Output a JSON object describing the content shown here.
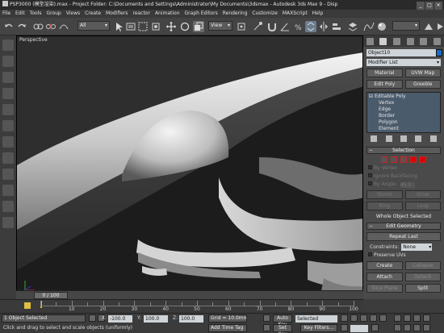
{
  "window": {
    "title": "PSP3000 (模型渲染).max  - Project Folder: C:\\Documents and Settings\\Administrator\\My Documents\\3dsmax   - Autodesk 3ds Max 9   - Disp"
  },
  "menu": [
    "File",
    "Edit",
    "Tools",
    "Group",
    "Views",
    "Create",
    "Modifiers",
    "reactor",
    "Animation",
    "Graph Editors",
    "Rendering",
    "Customize",
    "MAXScript",
    "Help"
  ],
  "toolbar": {
    "selection_filter": "All",
    "ref_coord": "View"
  },
  "viewport": {
    "label": "Perspective"
  },
  "command_panel": {
    "object_name": "Object10",
    "object_color": "#1b6dc1",
    "modifier_list": "Modifier List",
    "buttons_row1": [
      "Material",
      "UVW Map"
    ],
    "buttons_row2": [
      "Edit Poly",
      "Greeble"
    ],
    "stack": {
      "root": "Editable Poly",
      "subobjects": [
        "Vertex",
        "Edge",
        "Border",
        "Polygon",
        "Element"
      ]
    },
    "selection_rollout": {
      "title": "Selection",
      "checks": [
        "By Vertex",
        "Ignore Backfacing",
        "By Angle:"
      ],
      "angle_value": "45.0",
      "shrink": "Shrink",
      "grow": "Grow",
      "ring": "Ring",
      "loop": "Loop",
      "status": "Whole Object Selected"
    },
    "edit_geometry": {
      "title": "Edit Geometry",
      "repeat_last": "Repeat Last",
      "constraints_label": "Constraints:",
      "constraints_value": "None",
      "preserve_uvs": "Preserve UVs",
      "create": "Create",
      "collapse": "Collapse",
      "attach": "Attach",
      "detach": "Detach",
      "slice_plane": "Slice Plane",
      "split": "Split"
    }
  },
  "timeline": {
    "slider_label": "0 / 100",
    "ticks": [
      "0",
      "10",
      "20",
      "30",
      "40",
      "50",
      "60",
      "70",
      "80",
      "90",
      "100"
    ]
  },
  "status": {
    "selection_info": "1 Object Selected",
    "prompt": "Click and drag to select and scale objects (uniformly)",
    "x_label": "X:",
    "x_value": "-100.0",
    "y_label": "Y:",
    "y_value": "100.0",
    "z_label": "Z:",
    "z_value": "100.0",
    "grid": "Grid = 10.0mm",
    "add_time_tag": "Add Time Tag",
    "auto_key": "Auto Key",
    "set_key": "Set Key",
    "selected": "Selected",
    "key_filters": "Key Filters..."
  }
}
